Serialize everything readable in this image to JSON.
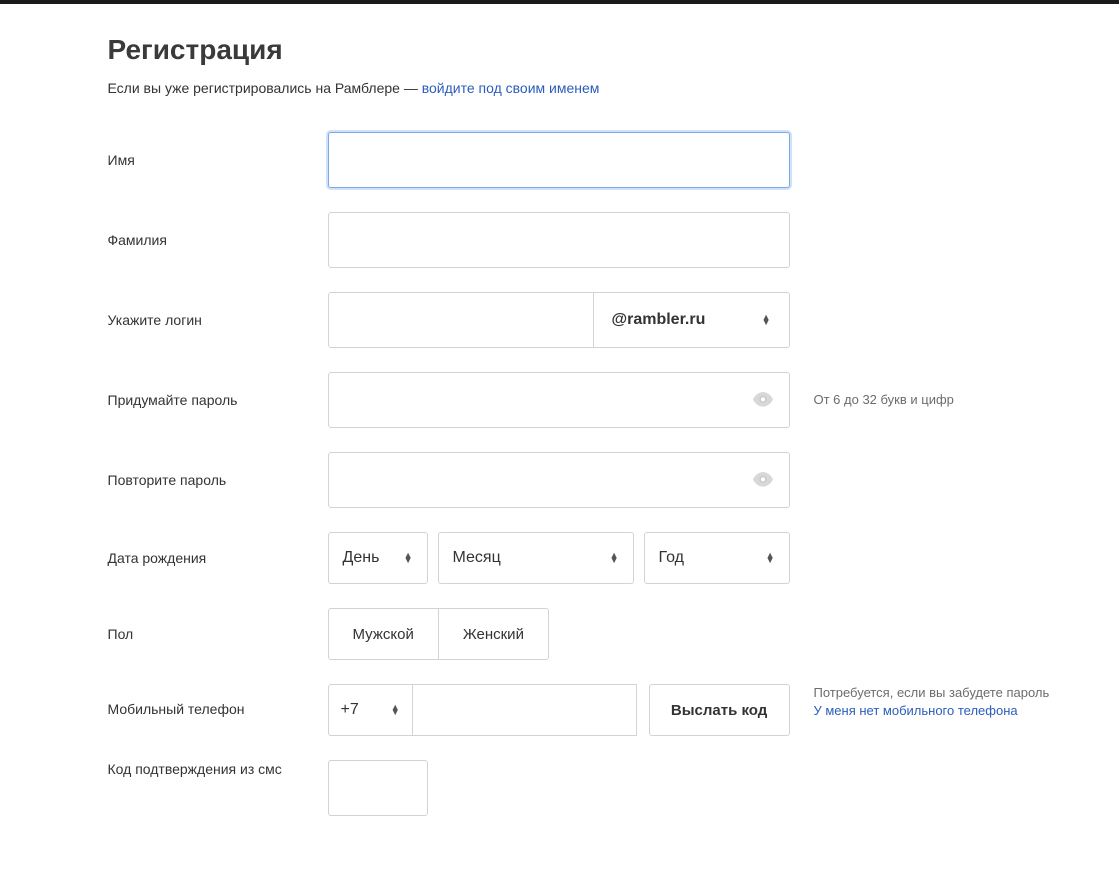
{
  "title": "Регистрация",
  "already_text": "Если вы уже регистрировались на Рамблере — ",
  "login_link": "войдите под своим именем",
  "labels": {
    "firstname": "Имя",
    "lastname": "Фамилия",
    "login": "Укажите логин",
    "password": "Придумайте пароль",
    "repeat_password": "Повторите пароль",
    "birthdate": "Дата рождения",
    "gender": "Пол",
    "phone": "Мобильный телефон",
    "code": "Код подтверждения из смс"
  },
  "login_domain": "@rambler.ru",
  "password_hint": "От 6 до 32 букв и цифр",
  "date": {
    "day": "День",
    "month": "Месяц",
    "year": "Год"
  },
  "gender": {
    "male": "Мужской",
    "female": "Женский"
  },
  "phone": {
    "prefix": "+7",
    "send_btn": "Выслать код",
    "hint1": "Потребуется, если вы забудете пароль",
    "hint2": "У меня нет мобильного телефона"
  }
}
